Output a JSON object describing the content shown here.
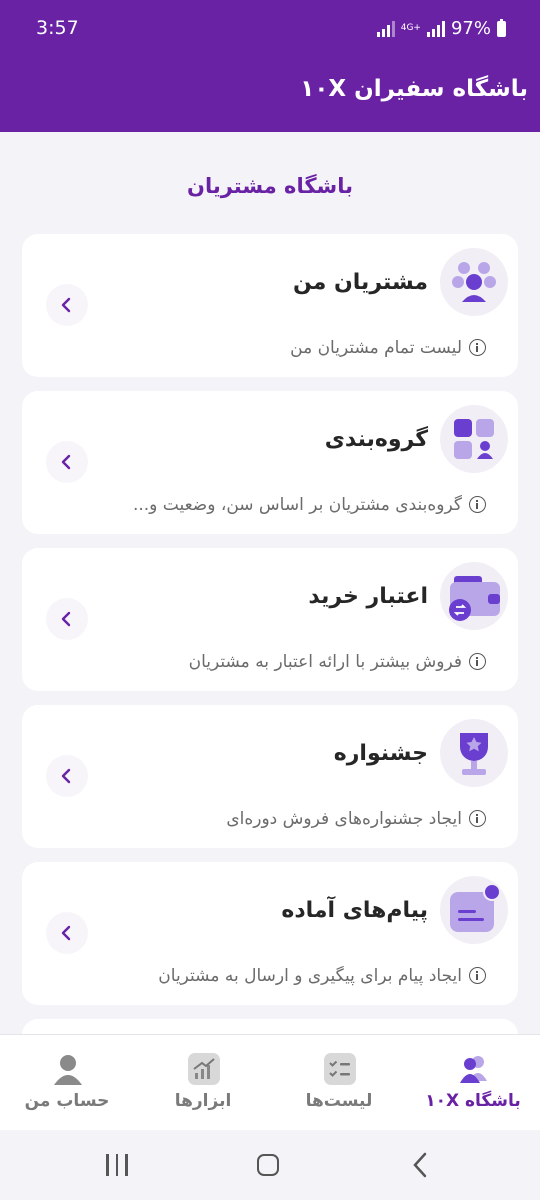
{
  "status_bar": {
    "time": "3:57",
    "network": "4G+",
    "battery": "97%"
  },
  "app_bar": {
    "title": "باشگاه سفیران ۱۰X"
  },
  "section": {
    "title": "باشگاه مشتریان"
  },
  "cards": [
    {
      "title": "مشتریان من",
      "description": "لیست تمام مشتریان من",
      "icon": "customers-icon"
    },
    {
      "title": "گروه‌بندی",
      "description": "گروه‌بندی مشتریان بر اساس سن، وضعیت و...",
      "icon": "grouping-icon"
    },
    {
      "title": "اعتبار خرید",
      "description": "فروش بیشتر با ارائه اعتبار به مشتریان",
      "icon": "wallet-credit-icon"
    },
    {
      "title": "جشنواره",
      "description": "ایجاد جشنواره‌های فروش دوره‌ای",
      "icon": "trophy-icon"
    },
    {
      "title": "پیام‌های آماده",
      "description": "ایجاد پیام برای پیگیری و ارسال به مشتریان",
      "icon": "message-icon"
    }
  ],
  "bottom_nav": {
    "items": [
      {
        "label": "باشگاه ۱۰X",
        "icon": "club-users-icon",
        "active": true
      },
      {
        "label": "لیست‌ها",
        "icon": "checklist-icon",
        "active": false
      },
      {
        "label": "ابزارها",
        "icon": "chart-tools-icon",
        "active": false
      },
      {
        "label": "حساب من",
        "icon": "profile-icon",
        "active": false
      }
    ]
  },
  "colors": {
    "primary": "#6a22a5",
    "icon_light": "#b9a6e8",
    "icon_dark": "#6a3fd0",
    "background": "#f4f3f7"
  }
}
